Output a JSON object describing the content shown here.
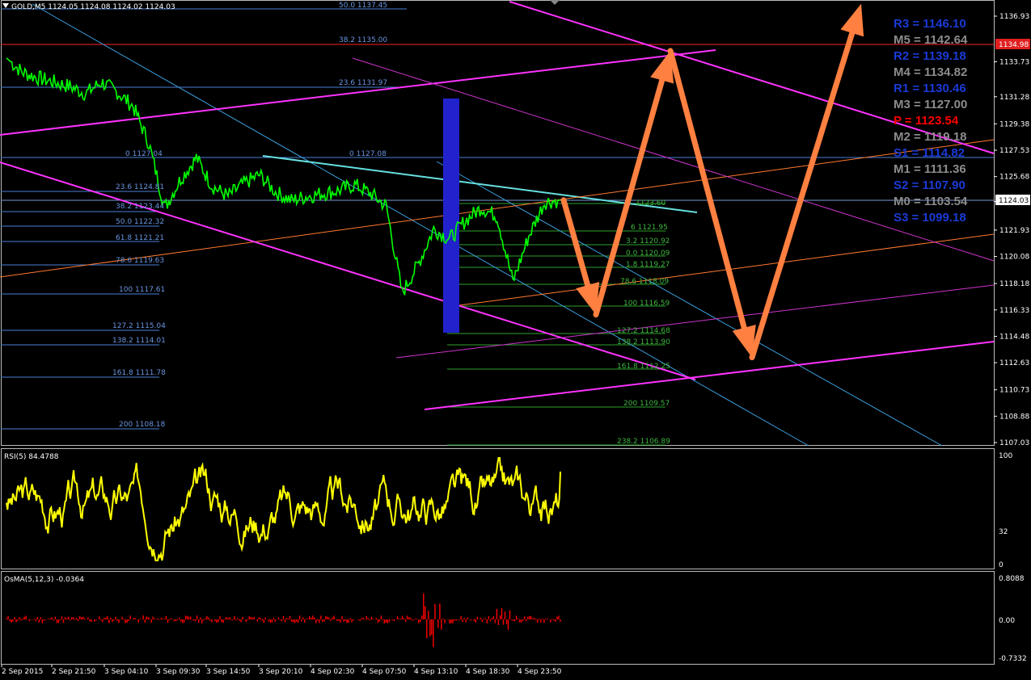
{
  "colors": {
    "background": "#000000",
    "price_line": "#00ff00",
    "fibo_left": "#4a7fd6",
    "fibo_right": "#2ea02e",
    "magenta": "#ff33ff",
    "orange_arrow": "#ff8040",
    "rsi": "#ffff00",
    "osma": "#ff0000",
    "pivot_blue": "#1a3ad6",
    "pivot_gray": "#8c8c8c",
    "pivot_red": "#ff0000",
    "blue_rect": "#2222cc",
    "cyan_line": "#66e0e0"
  },
  "header": {
    "title": "GOLD,M5  1124.05 1124.08 1124.02 1124.03",
    "menu_icon": "triangle-down-icon"
  },
  "price_axis": {
    "ticks": [
      "1136.93",
      "1133.73",
      "1131.28",
      "1129.38",
      "1127.53",
      "1125.68",
      "1123.93",
      "1121.93",
      "1120.08",
      "1118.18",
      "1116.33",
      "1114.48",
      "1112.63",
      "1110.73",
      "1108.88",
      "1107.03"
    ],
    "highlight_red": "1134.98",
    "highlight_current": "1124.03"
  },
  "time_axis": {
    "ticks": [
      "2 Sep 2015",
      "2 Sep 21:50",
      "3 Sep 04:10",
      "3 Sep 09:30",
      "3 Sep 14:50",
      "3 Sep 20:10",
      "4 Sep 02:30",
      "4 Sep 07:50",
      "4 Sep 13:10",
      "4 Sep 18:30",
      "4 Sep 23:50"
    ]
  },
  "fibo_left_labels": {
    "upper": [
      "50.0 1137.45",
      "38.2 1135.00",
      "23.6 1131.97",
      "0 1127.04"
    ],
    "lower": [
      "23.6 1124.81",
      "38.2 1123.44",
      "50.0 1122.32",
      "61.8 1121.21",
      "78.6 1119.63",
      "100 1117.61",
      "127.2 1115.04",
      "138.2 1114.01",
      "161.8 1111.78",
      "200 1108.18"
    ],
    "mid": "0 1127.08"
  },
  "fibo_right_labels": [
    "1123.60",
    "6 1121.95",
    "3.2 1120.92",
    "0.0 1120.09",
    "1.8 1119.27",
    "78.6 1118.09",
    "100 1116.59",
    "127.2 1114.68",
    "138.2 1113.90",
    "161.8 1112.25",
    "200 1109.57",
    "238.2 1106.89"
  ],
  "pivots": [
    {
      "label": "R3 = 1146.10",
      "color": "#1a3ad6"
    },
    {
      "label": "M5 = 1142.64",
      "color": "#8c8c8c"
    },
    {
      "label": "R2 = 1139.18",
      "color": "#1a3ad6"
    },
    {
      "label": "M4 = 1134.82",
      "color": "#8c8c8c"
    },
    {
      "label": "R1 = 1130.46",
      "color": "#1a3ad6"
    },
    {
      "label": "M3 = 1127.00",
      "color": "#8c8c8c"
    },
    {
      "label": "P   = 1123.54",
      "color": "#ff0000"
    },
    {
      "label": "M2 = 1119.18",
      "color": "#8c8c8c"
    },
    {
      "label": "S1 = 1114.82",
      "color": "#1a3ad6"
    },
    {
      "label": "M1 = 1111.36",
      "color": "#8c8c8c"
    },
    {
      "label": "S2 = 1107.90",
      "color": "#1a3ad6"
    },
    {
      "label": "M0 = 1103.54",
      "color": "#8c8c8c"
    },
    {
      "label": "S3 = 1099.18",
      "color": "#1a3ad6"
    }
  ],
  "rsi": {
    "title": "RSI(5) 84.4788",
    "ticks": [
      "100",
      "32",
      "0"
    ]
  },
  "osma": {
    "title": "OsMA(5,12,3) -0.0364",
    "ticks": [
      "0.8088",
      "0.00",
      "-0.7332"
    ]
  },
  "chart_data": {
    "type": "line",
    "title": "GOLD,M5  1124.05 1124.08 1124.02 1124.03",
    "x_ticks": [
      "2 Sep 2015",
      "2 Sep 21:50",
      "3 Sep 04:10",
      "3 Sep 09:30",
      "3 Sep 14:50",
      "3 Sep 20:10",
      "4 Sep 02:30",
      "4 Sep 07:50",
      "4 Sep 13:10",
      "4 Sep 18:30",
      "4 Sep 23:50"
    ],
    "ylim": [
      1107.03,
      1136.93
    ],
    "series": [
      {
        "name": "GOLD,M5",
        "values": [
          1134.0,
          1133.0,
          1132.6,
          1132.3,
          1132.0,
          1131.5,
          1132.3,
          1131.6,
          1130.6,
          1128.0,
          1123.5,
          1125.5,
          1127.0,
          1125.0,
          1124.3,
          1125.2,
          1125.8,
          1124.6,
          1124.0,
          1124.3,
          1124.5,
          1124.7,
          1125.1,
          1124.5,
          1123.6,
          1117.5,
          1119.5,
          1122.0,
          1121.3,
          1122.6,
          1123.5,
          1122.9,
          1118.3,
          1121.5,
          1123.9,
          1124.03
        ]
      }
    ],
    "pivots_ylim": [
      1099.18,
      1146.1
    ],
    "fibo_levels": [
      "1137.45",
      "1135.00",
      "1131.97",
      "1127.04",
      "1124.81",
      "1123.44",
      "1122.32",
      "1121.21",
      "1119.63",
      "1117.61",
      "1115.04",
      "1114.01",
      "1111.78",
      "1108.18"
    ],
    "projected_path": [
      1124.03,
      1116.0,
      1134.5,
      1113.0,
      1137.8
    ]
  }
}
